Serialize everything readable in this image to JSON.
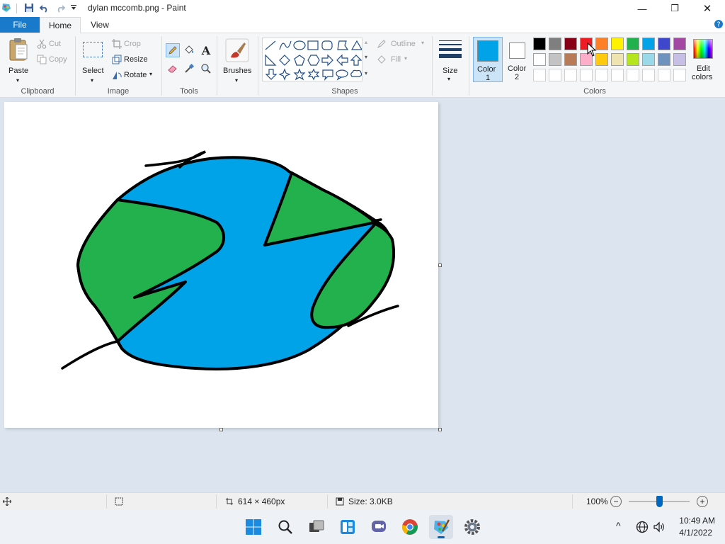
{
  "window": {
    "title": "dylan mccomb.png - Paint",
    "minimize": "—",
    "maximize": "❐",
    "close": "✕"
  },
  "tabs": {
    "file": "File",
    "home": "Home",
    "view": "View",
    "help": "?"
  },
  "clipboard": {
    "label": "Clipboard",
    "paste": "Paste",
    "cut": "Cut",
    "copy": "Copy"
  },
  "image": {
    "label": "Image",
    "select": "Select",
    "crop": "Crop",
    "resize": "Resize",
    "rotate": "Rotate"
  },
  "tools": {
    "label": "Tools",
    "text_glyph": "A"
  },
  "brushes": {
    "label": "Brushes"
  },
  "shapes": {
    "label": "Shapes",
    "outline": "Outline",
    "fill": "Fill"
  },
  "size": {
    "label": "Size"
  },
  "color1": {
    "label1": "Color",
    "label2": "1",
    "value": "#00a2e8"
  },
  "color2": {
    "label1": "Color",
    "label2": "2",
    "value": "#ffffff"
  },
  "colors": {
    "label": "Colors",
    "edit_label1": "Edit",
    "edit_label2": "colors",
    "palette_row1": [
      "#000000",
      "#7f7f7f",
      "#880015",
      "#ed1c24",
      "#ff7f27",
      "#fff200",
      "#22b14c",
      "#00a2e8",
      "#3f48cc",
      "#a349a4"
    ],
    "palette_row2": [
      "#ffffff",
      "#c3c3c3",
      "#b97a57",
      "#ffaec9",
      "#ffc90e",
      "#efe4b0",
      "#b5e61d",
      "#99d9ea",
      "#7092be",
      "#c8bfe7"
    ]
  },
  "drawing": {
    "blue": "#00a2e8",
    "green": "#22b14c",
    "stroke": "#000000"
  },
  "status": {
    "dimensions": "614 × 460px",
    "size": "Size: 3.0KB",
    "zoom": "100%",
    "zoom_minus": "−",
    "zoom_plus": "+"
  },
  "tray": {
    "time": "10:49 AM",
    "date": "4/1/2022",
    "chevron": "^"
  }
}
